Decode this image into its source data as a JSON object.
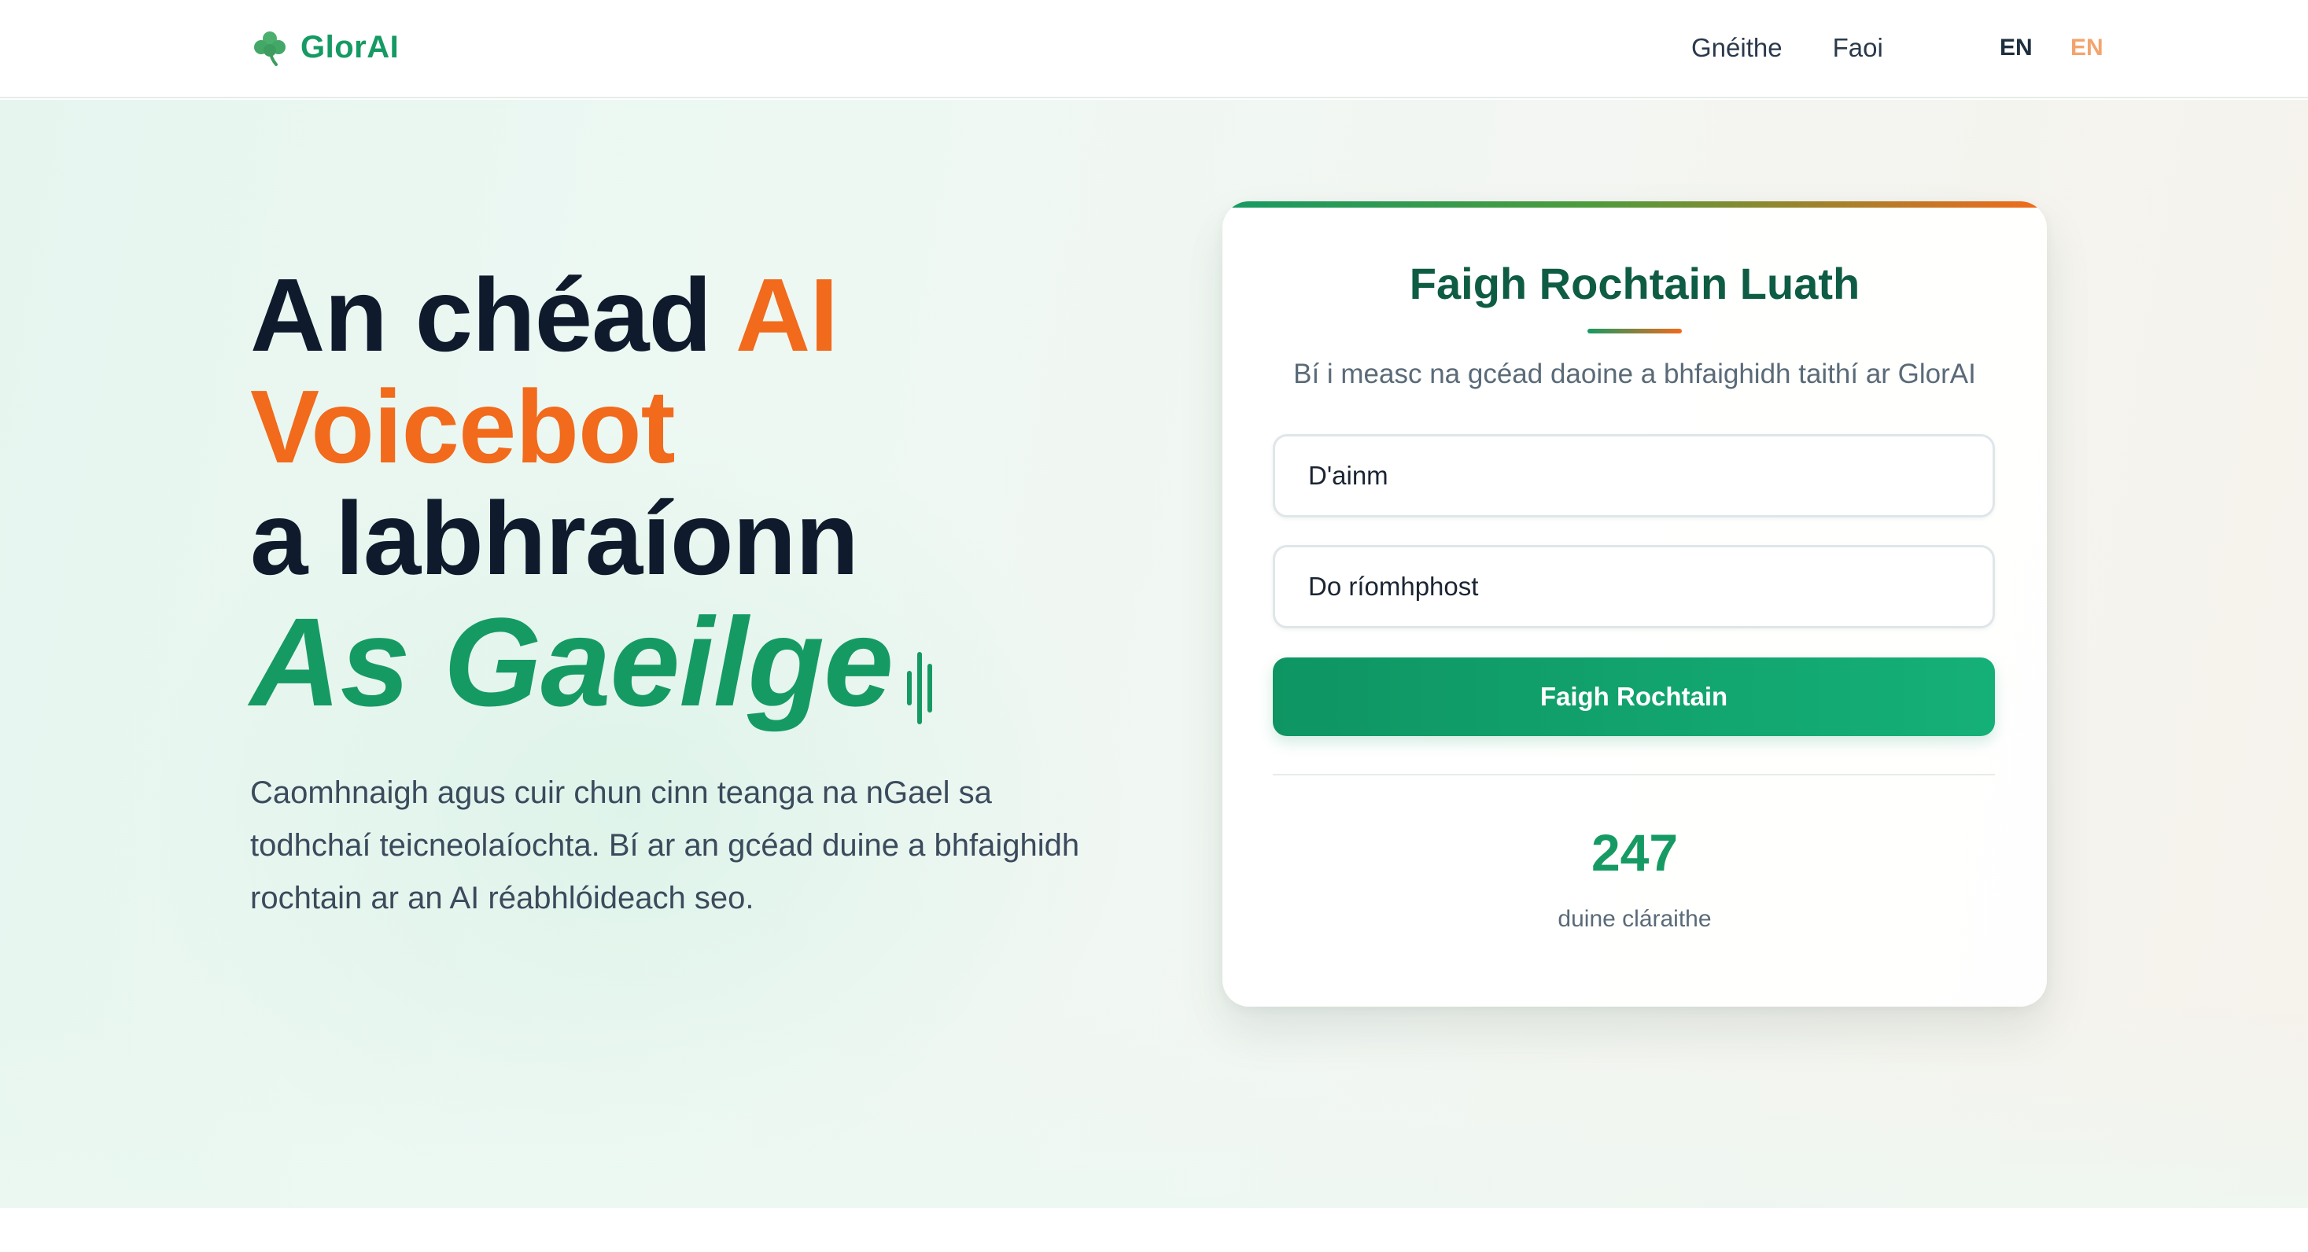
{
  "brand": {
    "name": "GlorAI",
    "icon": "shamrock-icon",
    "color": "#169a63"
  },
  "nav": {
    "links": [
      "Gnéithe",
      "Faoi"
    ],
    "languages": [
      "EN",
      "EN"
    ]
  },
  "hero": {
    "headline": {
      "line1_part1": "An chéad ",
      "line1_part2": "AI",
      "line2": "Voicebot",
      "line3": "a labhraíonn",
      "line4": "As Gaeilge"
    },
    "description": "Caomhnaigh agus cuir chun cinn teanga na nGael sa todhchaí teicneolaíochta. Bí ar an gcéad duine a bhfaighidh rochtain ar an AI réabhlóideach seo."
  },
  "signup": {
    "title": "Faigh Rochtain Luath",
    "subtitle": "Bí i measc na gcéad daoine a bhfaighidh taithí ar GlorAI",
    "name_placeholder": "D'ainm",
    "email_placeholder": "Do ríomhphost",
    "button": "Faigh Rochtain",
    "count": "247",
    "count_label": "duine cláraithe"
  },
  "colors": {
    "accent_green": "#169a63",
    "accent_orange": "#f26a1b",
    "text_dark": "#0f1b2d"
  }
}
